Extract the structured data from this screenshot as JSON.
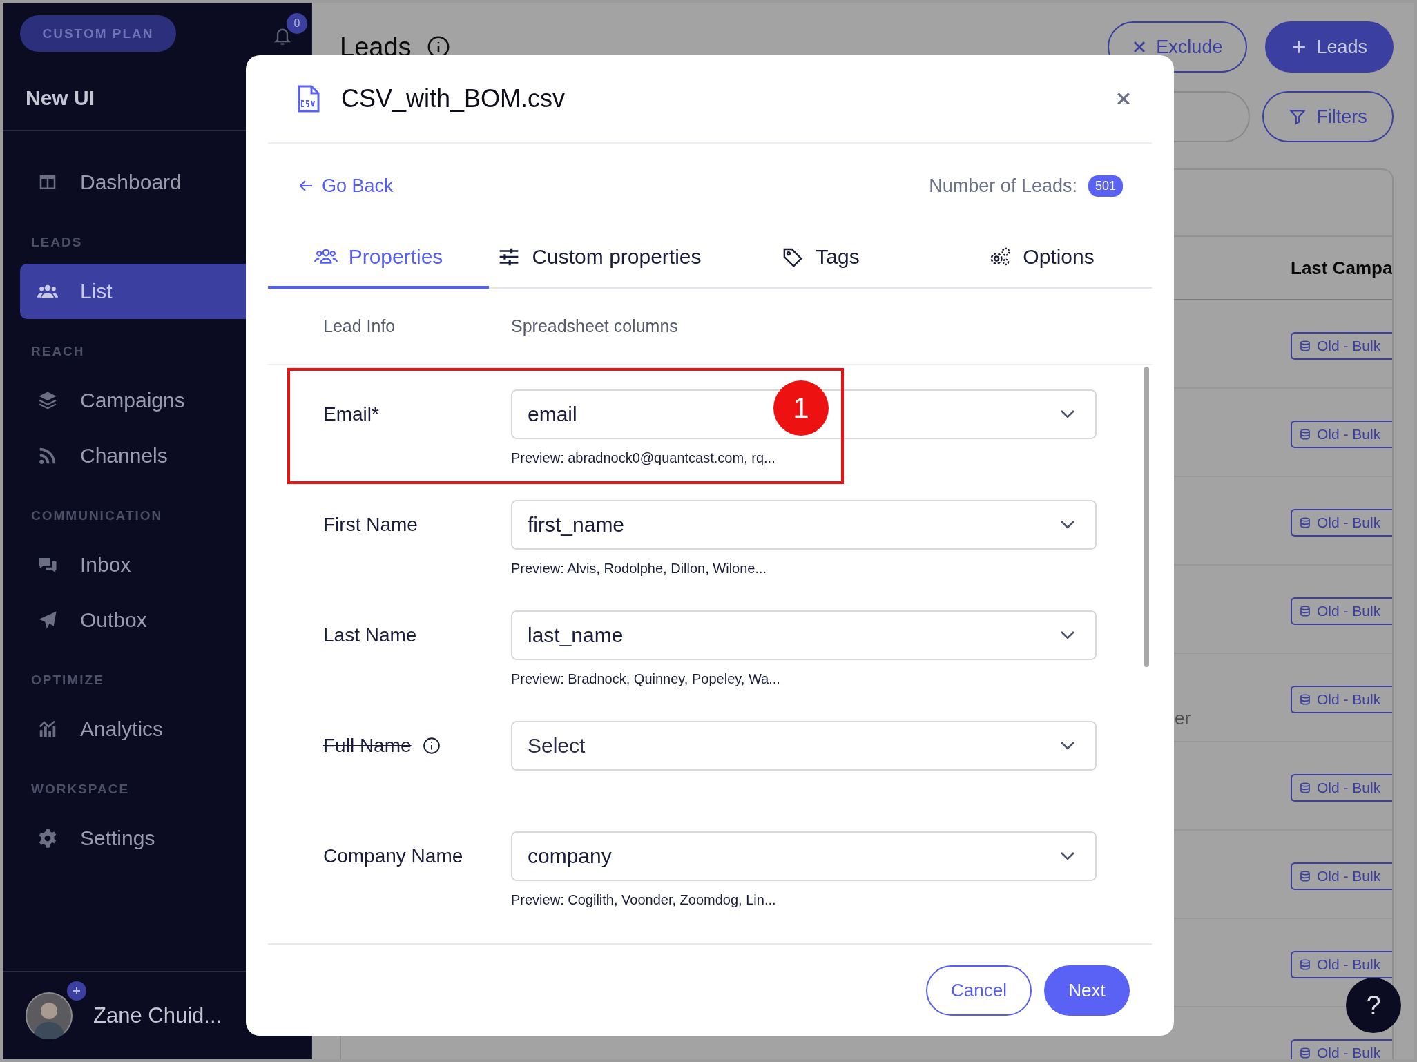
{
  "sidebar": {
    "plan": "CUSTOM PLAN",
    "notification_count": "0",
    "workspace": "New UI",
    "items": [
      {
        "kind": "item",
        "label": "Dashboard",
        "selected": false
      },
      {
        "kind": "section",
        "label": "LEADS"
      },
      {
        "kind": "item",
        "label": "List",
        "selected": true
      },
      {
        "kind": "section",
        "label": "REACH"
      },
      {
        "kind": "item",
        "label": "Campaigns",
        "selected": false
      },
      {
        "kind": "item",
        "label": "Channels",
        "selected": false
      },
      {
        "kind": "section",
        "label": "COMMUNICATION"
      },
      {
        "kind": "item",
        "label": "Inbox",
        "selected": false
      },
      {
        "kind": "item",
        "label": "Outbox",
        "selected": false
      },
      {
        "kind": "section",
        "label": "OPTIMIZE"
      },
      {
        "kind": "item",
        "label": "Analytics",
        "selected": false
      },
      {
        "kind": "section",
        "label": "WORKSPACE"
      },
      {
        "kind": "item",
        "label": "Settings",
        "selected": false
      }
    ],
    "user": {
      "name": "Zane Chuid..."
    }
  },
  "page": {
    "title": "Leads",
    "buttons": [
      {
        "label": "Exclude",
        "kind": "outline"
      },
      {
        "label": "Leads",
        "kind": "primary"
      }
    ],
    "filters_button": "Filters"
  },
  "table": {
    "columns": [
      "Last Campa"
    ],
    "rows": [
      {
        "tag": "Old - Bulk"
      },
      {
        "tag": "Old - Bulk"
      },
      {
        "tag": "Old - Bulk"
      },
      {
        "tag": "Old - Bulk"
      },
      {
        "column_2": "er",
        "tag": "Old - Bulk"
      },
      {
        "tag": "Old - Bulk"
      },
      {
        "tag": "Old - Bulk"
      },
      {
        "tag": "Old - Bulk"
      },
      {
        "tag": "Old - Bulk"
      }
    ]
  },
  "modal": {
    "file_name": "CSV_with_BOM.csv",
    "back": "Go Back",
    "lead_count_label": "Number of Leads:",
    "lead_count": "501",
    "tabs": [
      {
        "label": "Properties",
        "selected": true
      },
      {
        "label": "Custom properties",
        "selected": false
      },
      {
        "label": "Tags",
        "selected": false
      },
      {
        "label": "Options",
        "selected": false
      }
    ],
    "columns": [
      "Lead Info",
      "Spreadsheet columns"
    ],
    "fields": [
      {
        "label": "Email*",
        "value": "email",
        "preview": "Preview: abradnock0@quantcast.com, rq...",
        "highlighted": true,
        "annotation": "1"
      },
      {
        "label": "First Name",
        "value": "first_name",
        "preview": "Preview: Alvis, Rodolphe, Dillon, Wilone..."
      },
      {
        "label": "Last Name",
        "value": "last_name",
        "preview": "Preview: Bradnock, Quinney, Popeley, Wa..."
      },
      {
        "label": "Full Name",
        "placeholder": "Select",
        "struck": true,
        "info": true
      },
      {
        "label": "Company Name",
        "value": "company",
        "preview": "Preview: Cogilith, Voonder, Zoomdog, Lin..."
      }
    ],
    "buttons": [
      {
        "label": "Cancel",
        "kind": "secondary"
      },
      {
        "label": "Next",
        "kind": "primary"
      }
    ]
  },
  "help_button": "?"
}
